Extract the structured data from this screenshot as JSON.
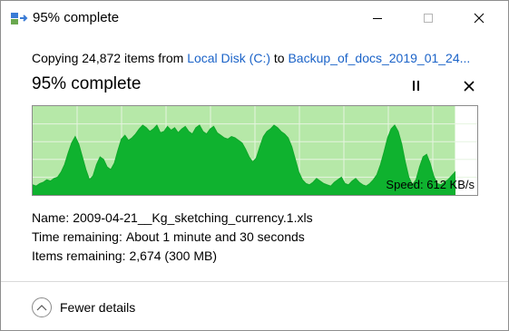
{
  "window": {
    "title": "95% complete",
    "controls": {
      "minimize": "minimize",
      "maximize": "maximize",
      "close": "close"
    }
  },
  "copy": {
    "prefix": "Copying 24,872 items from ",
    "source": "Local Disk (C:)",
    "to": " to ",
    "destination": "Backup_of_docs_2019_01_24..."
  },
  "progress": {
    "title": "95% complete",
    "percent": 95
  },
  "graph": {
    "speed_label": "Speed: 612 KB/s",
    "colors": {
      "done": "#b6e8a8",
      "line": "#0fa82a",
      "fill": "#0fb22f",
      "grid": "#d8f0cf"
    },
    "samples": [
      8,
      7,
      9,
      10,
      12,
      11,
      13,
      14,
      18,
      24,
      33,
      41,
      46,
      40,
      30,
      20,
      12,
      15,
      24,
      30,
      28,
      22,
      20,
      25,
      35,
      44,
      47,
      43,
      45,
      48,
      52,
      55,
      53,
      50,
      52,
      55,
      49,
      50,
      54,
      51,
      53,
      49,
      52,
      54,
      50,
      48,
      53,
      55,
      50,
      48,
      52,
      54,
      49,
      47,
      45,
      44,
      46,
      45,
      43,
      41,
      36,
      30,
      26,
      29,
      38,
      46,
      50,
      52,
      55,
      53,
      50,
      48,
      45,
      38,
      28,
      18,
      12,
      9,
      8,
      10,
      13,
      11,
      9,
      8,
      7,
      10,
      12,
      14,
      9,
      8,
      11,
      13,
      10,
      8,
      7,
      9,
      12,
      16,
      24,
      34,
      45,
      52,
      55,
      50,
      40,
      26,
      14,
      8,
      12,
      22,
      30,
      32,
      25,
      15,
      9,
      8,
      10,
      12,
      15,
      18
    ]
  },
  "details": {
    "name_label": "Name:",
    "name_value": "2009-04-21__Kg_sketching_currency.1.xls",
    "time_label": "Time remaining:",
    "time_value": "About 1 minute and 30 seconds",
    "items_label": "Items remaining:",
    "items_value": "2,674 (300 MB)"
  },
  "footer": {
    "fewer_details": "Fewer details"
  }
}
